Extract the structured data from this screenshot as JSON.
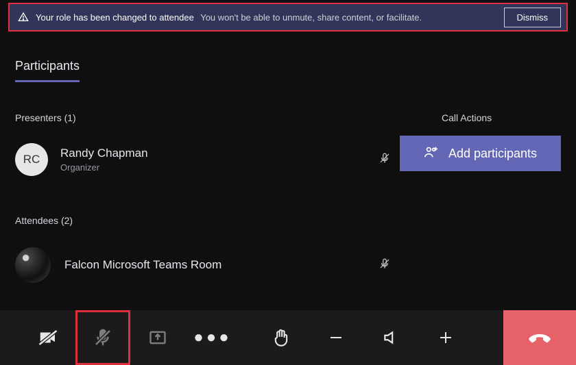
{
  "banner": {
    "strong": "Your role has been changed to attendee",
    "rest": "You won't be able to unmute, share content, or facilitate.",
    "dismiss": "Dismiss"
  },
  "headings": {
    "participants": "Participants",
    "call_actions": "Call Actions"
  },
  "presenters": {
    "label": "Presenters (1)",
    "items": [
      {
        "initials": "RC",
        "name": "Randy Chapman",
        "role": "Organizer"
      }
    ]
  },
  "attendees": {
    "label": "Attendees (2)",
    "items": [
      {
        "name": "Falcon Microsoft Teams Room"
      }
    ]
  },
  "add_button": "Add participants",
  "icons": {
    "warning": "warning-icon",
    "mic_off": "mic-off-icon",
    "camera_off": "camera-off-icon",
    "share": "share-icon",
    "more": "more-icon",
    "raise_hand": "raise-hand-icon",
    "minus": "minus-icon",
    "volume": "volume-icon",
    "plus": "plus-icon",
    "add_people": "add-people-icon",
    "hangup": "hangup-icon"
  },
  "colors": {
    "accent": "#6466b6",
    "highlight": "#e02f3c",
    "hangup_bg": "#e66168",
    "banner_bg": "#31355a"
  }
}
